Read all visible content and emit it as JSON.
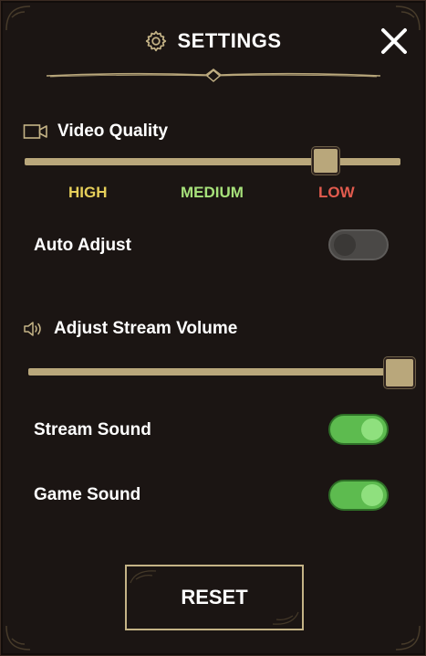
{
  "header": {
    "title": "SETTINGS",
    "icon": "gear-icon",
    "close_icon": "close-icon"
  },
  "video": {
    "title": "Video Quality",
    "icon": "video-camera-icon",
    "slider_value": 0.83,
    "labels": [
      {
        "text": "HIGH",
        "color": "#e6cf5a"
      },
      {
        "text": "MEDIUM",
        "color": "#a6e07a"
      },
      {
        "text": "LOW",
        "color": "#e25b4e"
      }
    ],
    "auto_adjust": {
      "label": "Auto Adjust",
      "enabled": false
    }
  },
  "volume": {
    "title": "Adjust Stream Volume",
    "icon": "speaker-icon",
    "slider_value": 1.0,
    "stream_sound": {
      "label": "Stream Sound",
      "enabled": true
    },
    "game_sound": {
      "label": "Game Sound",
      "enabled": true
    }
  },
  "reset": {
    "label": "RESET"
  },
  "colors": {
    "accent": "#b9a77b",
    "toggle_on": "#5dbb4f",
    "toggle_off": "#4a4846"
  }
}
